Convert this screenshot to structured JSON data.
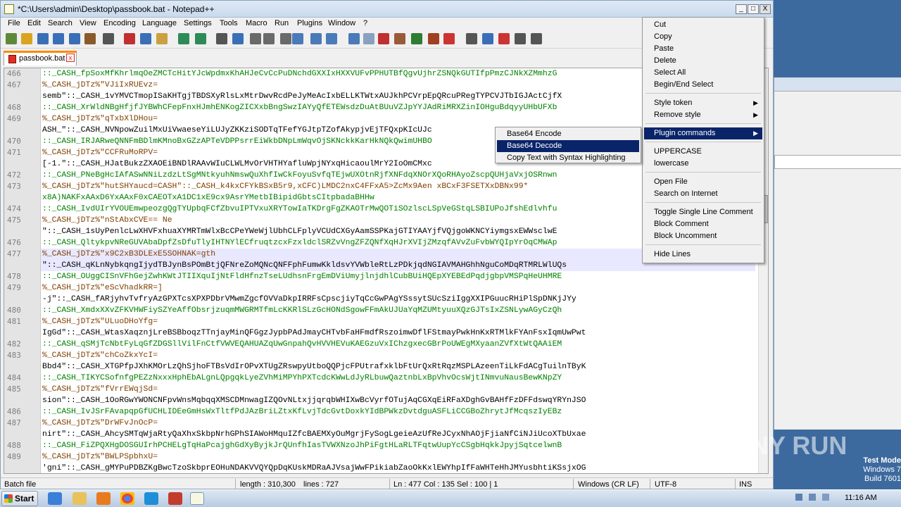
{
  "window": {
    "title": "*C:\\Users\\admin\\Desktop\\passbook.bat - Notepad++",
    "min": "_",
    "max": "□",
    "close": "X"
  },
  "menu": [
    "File",
    "Edit",
    "Search",
    "View",
    "Encoding",
    "Language",
    "Settings",
    "Tools",
    "Macro",
    "Run",
    "Plugins",
    "Window",
    "?"
  ],
  "tab": {
    "label": "passbook.bat",
    "close": "x"
  },
  "lines": [
    {
      "n": "466",
      "t": "::_CASH_fpSoxMfKhrlmqOeZMCTcHitYJcWpdmxKhAHJeCvCcPuDNchdGXXIxHXXVUFvPPHUTBfQgvUjhrZSNQkGUTIfpPmzCJNkXZMmhzG",
      "k": "comment"
    },
    {
      "n": "467",
      "t": "%_CASH_jDTz%\"VJiIxRUEvz=",
      "k": "var"
    },
    {
      "n": "",
      "t": "semb\"::_CASH_1vYMVCTmopISaKHTgjTBDSXyRlsLxMtrDwvRcdPeJyMeAcIxbELLKTWtxAUJkhPCVrpEpQRcuPRegTYPCVJTbIGJActCjfX",
      "k": "text"
    },
    {
      "n": "468",
      "t": "::_CASH_XrWldNBgHfjfJYBWhCFepFnxHJmhENKogZICXxbBngSwzIAYyQfETEWsdzDuAtBUuVZJpYYJAdRiMRXZinIOHguBdqyyUHbUFXb",
      "k": "comment"
    },
    {
      "n": "469",
      "t": "%_CASH_jDTz%\"qTxbXlDHou=",
      "k": "var"
    },
    {
      "n": "",
      "t": "ASH_\"::_CASH_NVNpowZuilMxUiVwaeseYiLUJyZKKziSODTqTFefYGJtpTZofAkypjvEjTFQxpKIcUJc",
      "k": "text"
    },
    {
      "n": "470",
      "t": "::_CASH_IRJARweQNNFmBDlmKMnoBxGZzAPTeVDPPsrrEiWkbDNpLmWqvOjSKNckkKarHkNQkQwimUHBO",
      "k": "comment"
    },
    {
      "n": "471",
      "t": "%_CASH_jDTz%\"CCFRuMoRPV=",
      "k": "var"
    },
    {
      "n": "",
      "t": "[-1.\"::_CASH_HJatBukzZXAOEiBNDlRAAvWIuCLWLMvOrVHTHYafluWpjNYxqHicaoulMrY2IoOmCMxc",
      "k": "text"
    },
    {
      "n": "472",
      "t": "::_CASH_PNeBgHcIAfASwNNiLzdzLtSgMNtkyuhNmswQuXhfIwCkFoyuSvfqTEjwUXOtnRjfXNFdqXNOrXQoRHAyoZscpQUHjaVxjOSRnwn",
      "k": "comment"
    },
    {
      "n": "473",
      "t": "%_CASH_jDTz%\"hutSHYaucd=CASH\"::_CASH_k4kxCFYkBSxB5r9,xCFC)LMDC2nxC4FFxA5>ZcMx9Aen xBCxF3FSETXxDBNx99*",
      "k": "var"
    },
    {
      "n": "",
      "t": "x8A)NAKFxAAxD6YxAAxF0xCAEOTxA1DC1xE9cx9AsrYMetbIBipidGbtsCItpbadaBHHw",
      "k": "comment"
    },
    {
      "n": "474",
      "t": "::_CASH_IvdUIrYVOUEmwpeozgQgTYUpbqFCfZbvuIPTVxuXRYTowIaTKDrgFgZKAOTrMwQOTiSOzlscLSpVeGStqLSBIUPoJfshEdlvhfu",
      "k": "comment"
    },
    {
      "n": "475",
      "t": "%_CASH_jDTz%\"nStAbxCVE== Ne",
      "k": "var"
    },
    {
      "n": "",
      "t": "\"::_CASH_1sUyPenlcLwXHVFxhuaXYMRTmWlxBcCPeYWeWjlUbhCLFplyVCUdCXGyAamSSPKajGTIYAAYjfVQjgoWKNCYiymgsxEWWsclwE",
      "k": "text"
    },
    {
      "n": "476",
      "t": "::_CASH_QltykpvNReGUVAbaDpfZsDfuTlyIHTNYlECfruqtzcxFzxldclSRZvVngZFZQNfXqHJrXVIjZMzqfAVvZuFvbWYQIpYrOqCMWAp",
      "k": "comment"
    },
    {
      "n": "477",
      "t": "%_CASH_jDTz%\"x9C2xB3DLExE5SOHNAK=gth",
      "k": "var"
    },
    {
      "n": "",
      "t": "\"::_CASH_qKLnNybkqngIjydTBJynBsPOmBtjQFNreZoMQNcQNFFphFumwKkldsvYVWbleRtLzPDkjqdNGIAVMAHGhhNguCoMDqRTMRLWlUQs",
      "k": "text"
    },
    {
      "n": "478",
      "t": "::_CASH_OUggCISnVFhGejZwhKWtJTIIXquIjNtFldHfnzTseLUdhsnFrgEmDViUmyjlnjdhlCubBUiHQEpXYEBEdPqdjgbpVMSPqHeUHMRE",
      "k": "comment"
    },
    {
      "n": "479",
      "t": "%_CASH_jDTz%\"eScVhadkRR=]",
      "k": "var"
    },
    {
      "n": "",
      "t": "-j\"::_CASH_fARjyhvTvfryAzGPXTcsXPXPDbrVMwmZgcfOVVaDkpIRRFsCpscjiyTqCcGwPAgYSssytSUcSziIggXXIPGuucRHiPlSpDNKjJYy",
      "k": "text"
    },
    {
      "n": "480",
      "t": "::_CASH_XmdxXXvZFKVHWFiySZYeAffObsrjzuqmMWGRMTfmLcKKRlSLzGcHONdSgowFFmAkUJUaYqMZUMtyuuXQzGJTsIxZSNLywAGyCzQh",
      "k": "comment"
    },
    {
      "n": "481",
      "t": "%_CASH_jDTz%\"ULuoDHoYfg=",
      "k": "var"
    },
    {
      "n": "",
      "t": "IgGd\"::_CASH_WtasXaqznjLreBSBboqzTTnjayMinQFGgzJypbPAdJmayCHTvbFaHFmdfRszoimwDflFStmayPwkHnKxRTMlkFYAnFsxIqmUwPwt",
      "k": "text"
    },
    {
      "n": "482",
      "t": "::_CASH_qSMjTcNbtFyLqGfZDGSllVilFnCtfVWVEQAHUAZqUwGnpahQvHVVHEVuKAEGzuVxIChzgxecGBrPoUWEgMXyaanZVfXtWtQAAiEM",
      "k": "comment"
    },
    {
      "n": "483",
      "t": "%_CASH_jDTz%\"chCoZkxYcI=",
      "k": "var"
    },
    {
      "n": "",
      "t": "Bbd4\"::_CASH_XTGPfpJXhKMOrLzQhSjhoFTBsVdIrOPvXTUgZRswpyUtboQQPjcFPUtrafxklbFtUrQxRtRqzMSPLAzeenTiLkFdACgTuilnTByK",
      "k": "text"
    },
    {
      "n": "484",
      "t": "::_CASH_TIKYCSofnfgPEZzNxxxHphEbALgnLQpgqkLyeZVhMiMPYhPXTcdcKWwLdJyRLbuwQaztnbLxBpVhvOcsWjtINmvuNausBewKNpZY",
      "k": "comment"
    },
    {
      "n": "485",
      "t": "%_CASH_jDTz%\"fVrrEWqjSd=",
      "k": "var"
    },
    {
      "n": "",
      "t": "sion\"::_CASH_1OoRGwYWONCNFpvWnsMqbqqXMSCDMnwagIZQOvNLtxjjqrqbWHIXwBcVyrfOTujAqCGXqEiRFaXDghGvBAHfFzDFFdswqYRYnJSO",
      "k": "text"
    },
    {
      "n": "486",
      "t": "::_CASH_IvJSrFAvapqpGfUCHLIDEeGmHsWxTltfPdJAzBriLZtxKfLvjTdcGvtDoxkYIdBPWkzDvtdguASFLiCCGBoZhrytJfMcqszIyEBz",
      "k": "comment"
    },
    {
      "n": "487",
      "t": "%_CASH_jDTz%\"DrWFvJnOcP=",
      "k": "var"
    },
    {
      "n": "",
      "t": "nirt\"::_CASH_AhcySMTqWjaRtyQaXhxSkbpNrhGPhSIAWoHMquIZfcBAEMXyOuMgrjFySogLgeieAzUfReJCyxNhAOjFjiaNfCiNJiUcoXTbUxae",
      "k": "text"
    },
    {
      "n": "488",
      "t": "::_CASH_FiZPQXHgDOSGUIrhPCHELgTqHaPcajghGdXyByjkJrQUnfhIasTVWXNzoJhPiFgtHLaRLTFqtwUupYcCSgbHqkkJpyjSqtcelwnB",
      "k": "comment"
    },
    {
      "n": "489",
      "t": "%_CASH_jDTz%\"BWLPSpbhxU=",
      "k": "var"
    },
    {
      "n": "",
      "t": "'gni\"::_CASH_gMYPuPDBZKgBwcTzoSkbprEOHuNDAKVVQYQpDqKUskMDRaAJVsajWwFPikiabZaoOkKxlEWYhpIfFaWHTeHhJMYusbhtiKSsjxOG",
      "k": "text"
    }
  ],
  "context_menu": {
    "items": [
      "Cut",
      "Copy",
      "Paste",
      "Delete",
      "Select All",
      "Begin/End Select",
      "Style token",
      "Remove style",
      "Plugin commands",
      "UPPERCASE",
      "lowercase",
      "Open File",
      "Search on Internet",
      "Toggle Single Line Comment",
      "Block Comment",
      "Block Uncomment",
      "Hide Lines"
    ]
  },
  "submenu": {
    "items": [
      "Base64 Encode",
      "Base64 Decode",
      "Copy Text with Syntax Highlighting"
    ]
  },
  "status": {
    "type": "Batch file",
    "length": "length : 310,300",
    "lines": "lines : 727",
    "pos": "Ln : 477   Col : 135   Sel : 100 | 1",
    "eol": "Windows (CR LF)",
    "enc": "UTF-8",
    "mode": "INS"
  },
  "taskbar": {
    "start": "Start",
    "clock": "11:16 AM"
  },
  "watermark": "ANY RUN",
  "os": {
    "l1": "Test Mode",
    "l2": "Windows 7",
    "l3": "Build 7601"
  }
}
